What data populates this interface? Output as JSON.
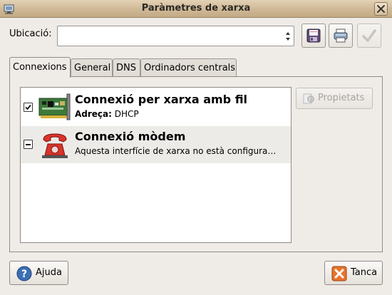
{
  "window": {
    "title": "Paràmetres de xarxa"
  },
  "location": {
    "label": "Ubicació:",
    "value": ""
  },
  "toolbar": {
    "buttons": [
      {
        "name": "save-location-icon"
      },
      {
        "name": "delete-location-icon"
      },
      {
        "name": "activate-location-icon"
      }
    ]
  },
  "tabs": [
    {
      "label": "Connexions",
      "active": true
    },
    {
      "label": "General"
    },
    {
      "label": "DNS"
    },
    {
      "label": "Ordinadors centrals"
    }
  ],
  "connections": [
    {
      "title": "Connexió per xarxa amb fil",
      "detail_label": "Adreça:",
      "detail_value": "DHCP",
      "state": "checked",
      "icon": "network-card-icon"
    },
    {
      "title": "Connexió mòdem",
      "detail_text": "Aquesta interfície de xarxa no està configura…",
      "state": "mixed",
      "icon": "modem-phone-icon"
    }
  ],
  "properties_button": {
    "label": "Propietats"
  },
  "footer": {
    "help_label": "Ajuda",
    "close_label": "Tanca"
  }
}
